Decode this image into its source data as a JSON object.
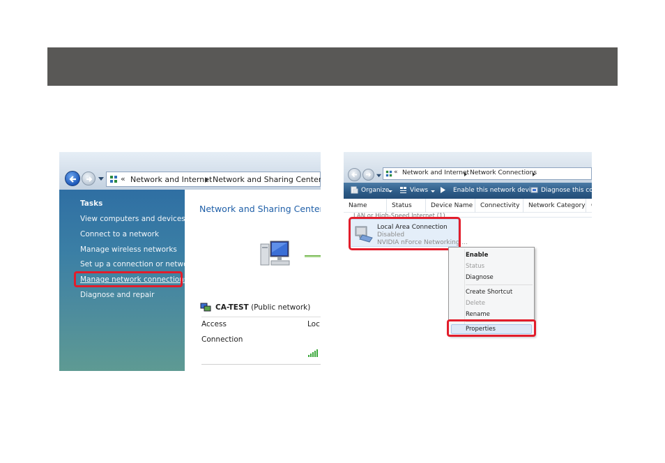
{
  "left_window": {
    "breadcrumb": [
      "Network and Internet",
      "Network and Sharing Center"
    ],
    "breadcrumb_chevron": "«",
    "tasks": {
      "title": "Tasks",
      "items": [
        "View computers and devices",
        "Connect to a network",
        "Manage wireless networks",
        "Set up a connection or network",
        "Manage network connections",
        "Diagnose and repair"
      ]
    },
    "content": {
      "title": "Network and Sharing Center",
      "network_name": "CA-TEST",
      "network_type": "(Public network)",
      "access_label": "Access",
      "access_value": "Loc",
      "connection_label": "Connection"
    }
  },
  "right_window": {
    "breadcrumb": [
      "Network and Internet",
      "Network Connections"
    ],
    "breadcrumb_chevron": "«",
    "toolbar": {
      "organize": "Organize",
      "views": "Views",
      "enable": "Enable this network device",
      "diagnose": "Diagnose this conn"
    },
    "columns": [
      "Name",
      "Status",
      "Device Name",
      "Connectivity",
      "Network Category",
      "C"
    ],
    "group_label": "LAN or High-Speed Internet (1)",
    "connection": {
      "name": "Local Area Connection",
      "status": "Disabled",
      "device": "NVIDIA nForce Networking ..."
    },
    "context_menu": {
      "enable": "Enable",
      "status": "Status",
      "diagnose": "Diagnose",
      "create_shortcut": "Create Shortcut",
      "delete": "Delete",
      "rename": "Rename",
      "properties": "Properties"
    }
  },
  "colors": {
    "header_bar": "#595856",
    "highlight_red": "#e21d2b",
    "task_pane_top": "#2f6fa3",
    "task_pane_bottom": "#5e9a93",
    "link_blue": "#1f5fa8"
  },
  "icons": [
    "back-arrow-icon",
    "forward-arrow-icon",
    "network-folder-icon",
    "computer-icon",
    "network-icon",
    "signal-strength-icon",
    "organize-icon",
    "views-icon",
    "enable-device-icon",
    "diagnose-icon",
    "lan-adapter-icon"
  ]
}
